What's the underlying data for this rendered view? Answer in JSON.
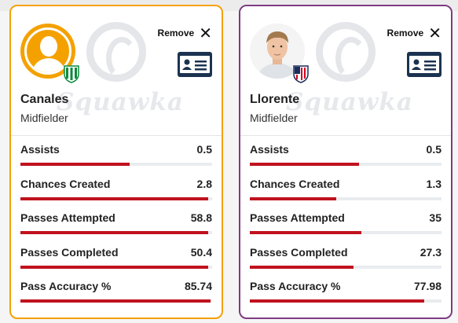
{
  "colors": {
    "betis": "#f4a100",
    "atletico": "#7d3b82",
    "bar": "#c0121e"
  },
  "players": [
    {
      "name": "Canales",
      "position": "Midfielder",
      "remove_label": "Remove",
      "watermark": "Squawka",
      "avatar": "generic-user-icon",
      "club_crest": "betis-crest-icon",
      "stats": [
        {
          "label": "Assists",
          "value": "0.5",
          "fill": 0.57
        },
        {
          "label": "Chances Created",
          "value": "2.8",
          "fill": 0.98
        },
        {
          "label": "Passes Attempted",
          "value": "58.8",
          "fill": 0.98
        },
        {
          "label": "Passes Completed",
          "value": "50.4",
          "fill": 0.98
        },
        {
          "label": "Pass Accuracy %",
          "value": "85.74",
          "fill": 0.99
        }
      ]
    },
    {
      "name": "Llorente",
      "position": "Midfielder",
      "remove_label": "Remove",
      "watermark": "Squawka",
      "avatar": "player-photo",
      "club_crest": "atletico-crest-icon",
      "stats": [
        {
          "label": "Assists",
          "value": "0.5",
          "fill": 0.57
        },
        {
          "label": "Chances Created",
          "value": "1.3",
          "fill": 0.45
        },
        {
          "label": "Passes Attempted",
          "value": "35",
          "fill": 0.58
        },
        {
          "label": "Passes Completed",
          "value": "27.3",
          "fill": 0.54
        },
        {
          "label": "Pass Accuracy %",
          "value": "77.98",
          "fill": 0.91
        }
      ]
    }
  ]
}
